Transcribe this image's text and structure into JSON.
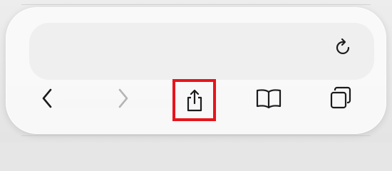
{
  "toolbar": {
    "buttons": [
      {
        "name": "reload",
        "icon": "reload-icon",
        "enabled": true
      },
      {
        "name": "back",
        "icon": "chevron-left-icon",
        "enabled": true
      },
      {
        "name": "forward",
        "icon": "chevron-right-icon",
        "enabled": false
      },
      {
        "name": "share",
        "icon": "share-icon",
        "enabled": true,
        "highlighted": true
      },
      {
        "name": "bookmarks",
        "icon": "book-icon",
        "enabled": true
      },
      {
        "name": "tabs",
        "icon": "tabs-icon",
        "enabled": true
      }
    ]
  },
  "colors": {
    "icon": "#1c1c1e",
    "icon_disabled": "#b5b5b5",
    "highlight": "#e8141b",
    "toolbar_bg": "#f8f8f8"
  }
}
